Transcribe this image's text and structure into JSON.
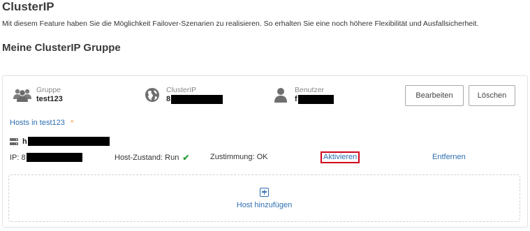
{
  "page": {
    "title": "ClusterIP",
    "description": "Mit diesem Feature haben Sie die Möglichkeit Failover-Szenarien zu realisieren. So erhalten Sie eine noch höhere Flexibilität und Ausfallsicherheit.",
    "group_heading": "Meine ClusterIP Gruppe"
  },
  "card": {
    "group": {
      "label": "Gruppe",
      "value": "test123",
      "icon": "users-icon"
    },
    "clusterip": {
      "label": "ClusterIP",
      "value_prefix": "8",
      "icon": "globe-icon"
    },
    "user": {
      "label": "Benutzer",
      "value_prefix": "f",
      "icon": "user-icon"
    },
    "buttons": {
      "edit": "Bearbeiten",
      "delete": "Löschen"
    },
    "hosts_toggle": "Hosts in test123",
    "host": {
      "name_prefix": "h",
      "ip_label": "IP: 8",
      "state_label": "Host-Zustand: Run",
      "consent_label": "Zustimmung: OK",
      "activate": "Aktivieren",
      "remove": "Entfernen"
    },
    "add_host": "Host hinzufügen"
  },
  "colors": {
    "link": "#2e6fb0",
    "chevron": "#f08a24",
    "check": "#2e9e3a",
    "highlight_border": "#d0021b"
  }
}
